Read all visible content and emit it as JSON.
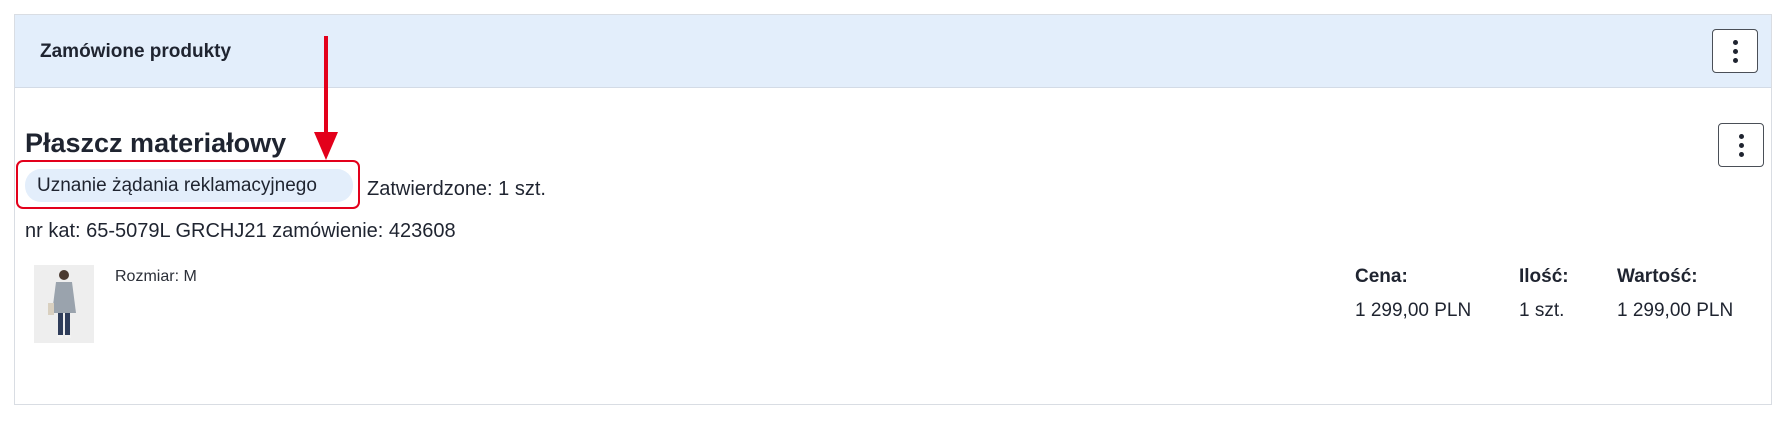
{
  "header": {
    "title": "Zamówione produkty",
    "menu_icon": "kebab-vertical-icon"
  },
  "product": {
    "name": "Płaszcz materiałowy",
    "status_badge": "Uznanie żądania reklamacyjnego",
    "approved": "Zatwierdzone: 1 szt.",
    "catalog": "nr kat: 65-5079L GRCHJ21 zamówienie: 423608",
    "size": "Rozmiar: M",
    "menu_icon": "kebab-vertical-icon"
  },
  "columns": {
    "price": {
      "label": "Cena:",
      "value": "1 299,00 PLN"
    },
    "quantity": {
      "label": "Ilość:",
      "value": "1 szt."
    },
    "total": {
      "label": "Wartość:",
      "value": "1 299,00 PLN"
    }
  },
  "colors": {
    "header_bg": "#e3eefb",
    "annotation": "#e3001b",
    "badge_bg": "#e3eefb"
  }
}
